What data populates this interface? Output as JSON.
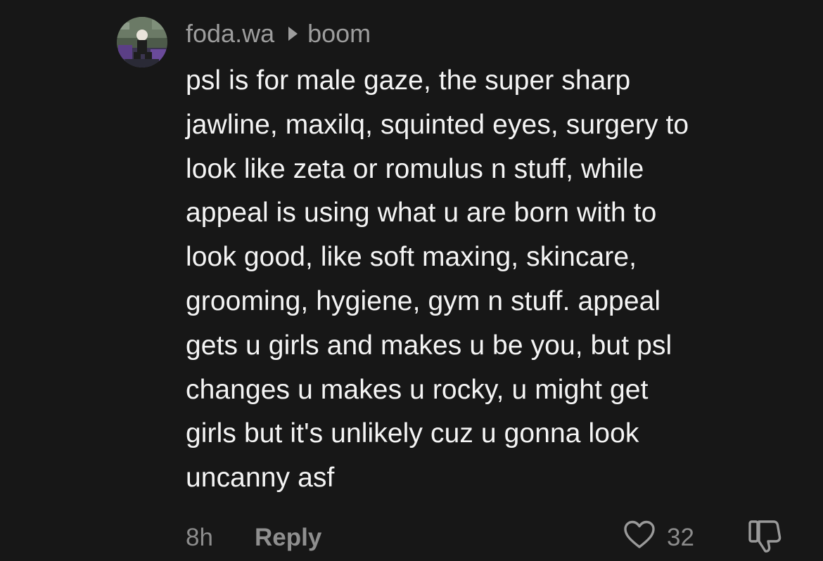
{
  "comment": {
    "author": "foda.wa",
    "reply_to": "boom",
    "text": "psl is for male gaze, the super sharp\njawline, maxilq, squinted eyes, surgery to\nlook like zeta or romulus n stuff, while\nappeal is using what u are born with to\nlook good, like soft maxing, skincare,\ngrooming, hygiene, gym n stuff. appeal\ngets u girls and makes u be you, but psl\nchanges u makes u rocky, u might get\ngirls but it's unlikely cuz u gonna look\nuncanny asf",
    "timestamp": "8h",
    "reply_label": "Reply",
    "like_count": "32",
    "icons": {
      "avatar": "user-avatar",
      "arrow": "reply-arrow-icon",
      "like": "heart-icon",
      "dislike": "thumbs-down-icon"
    }
  },
  "colors": {
    "background": "#171717",
    "text_primary": "#f4f4f4",
    "text_secondary": "#9d9d9d"
  }
}
